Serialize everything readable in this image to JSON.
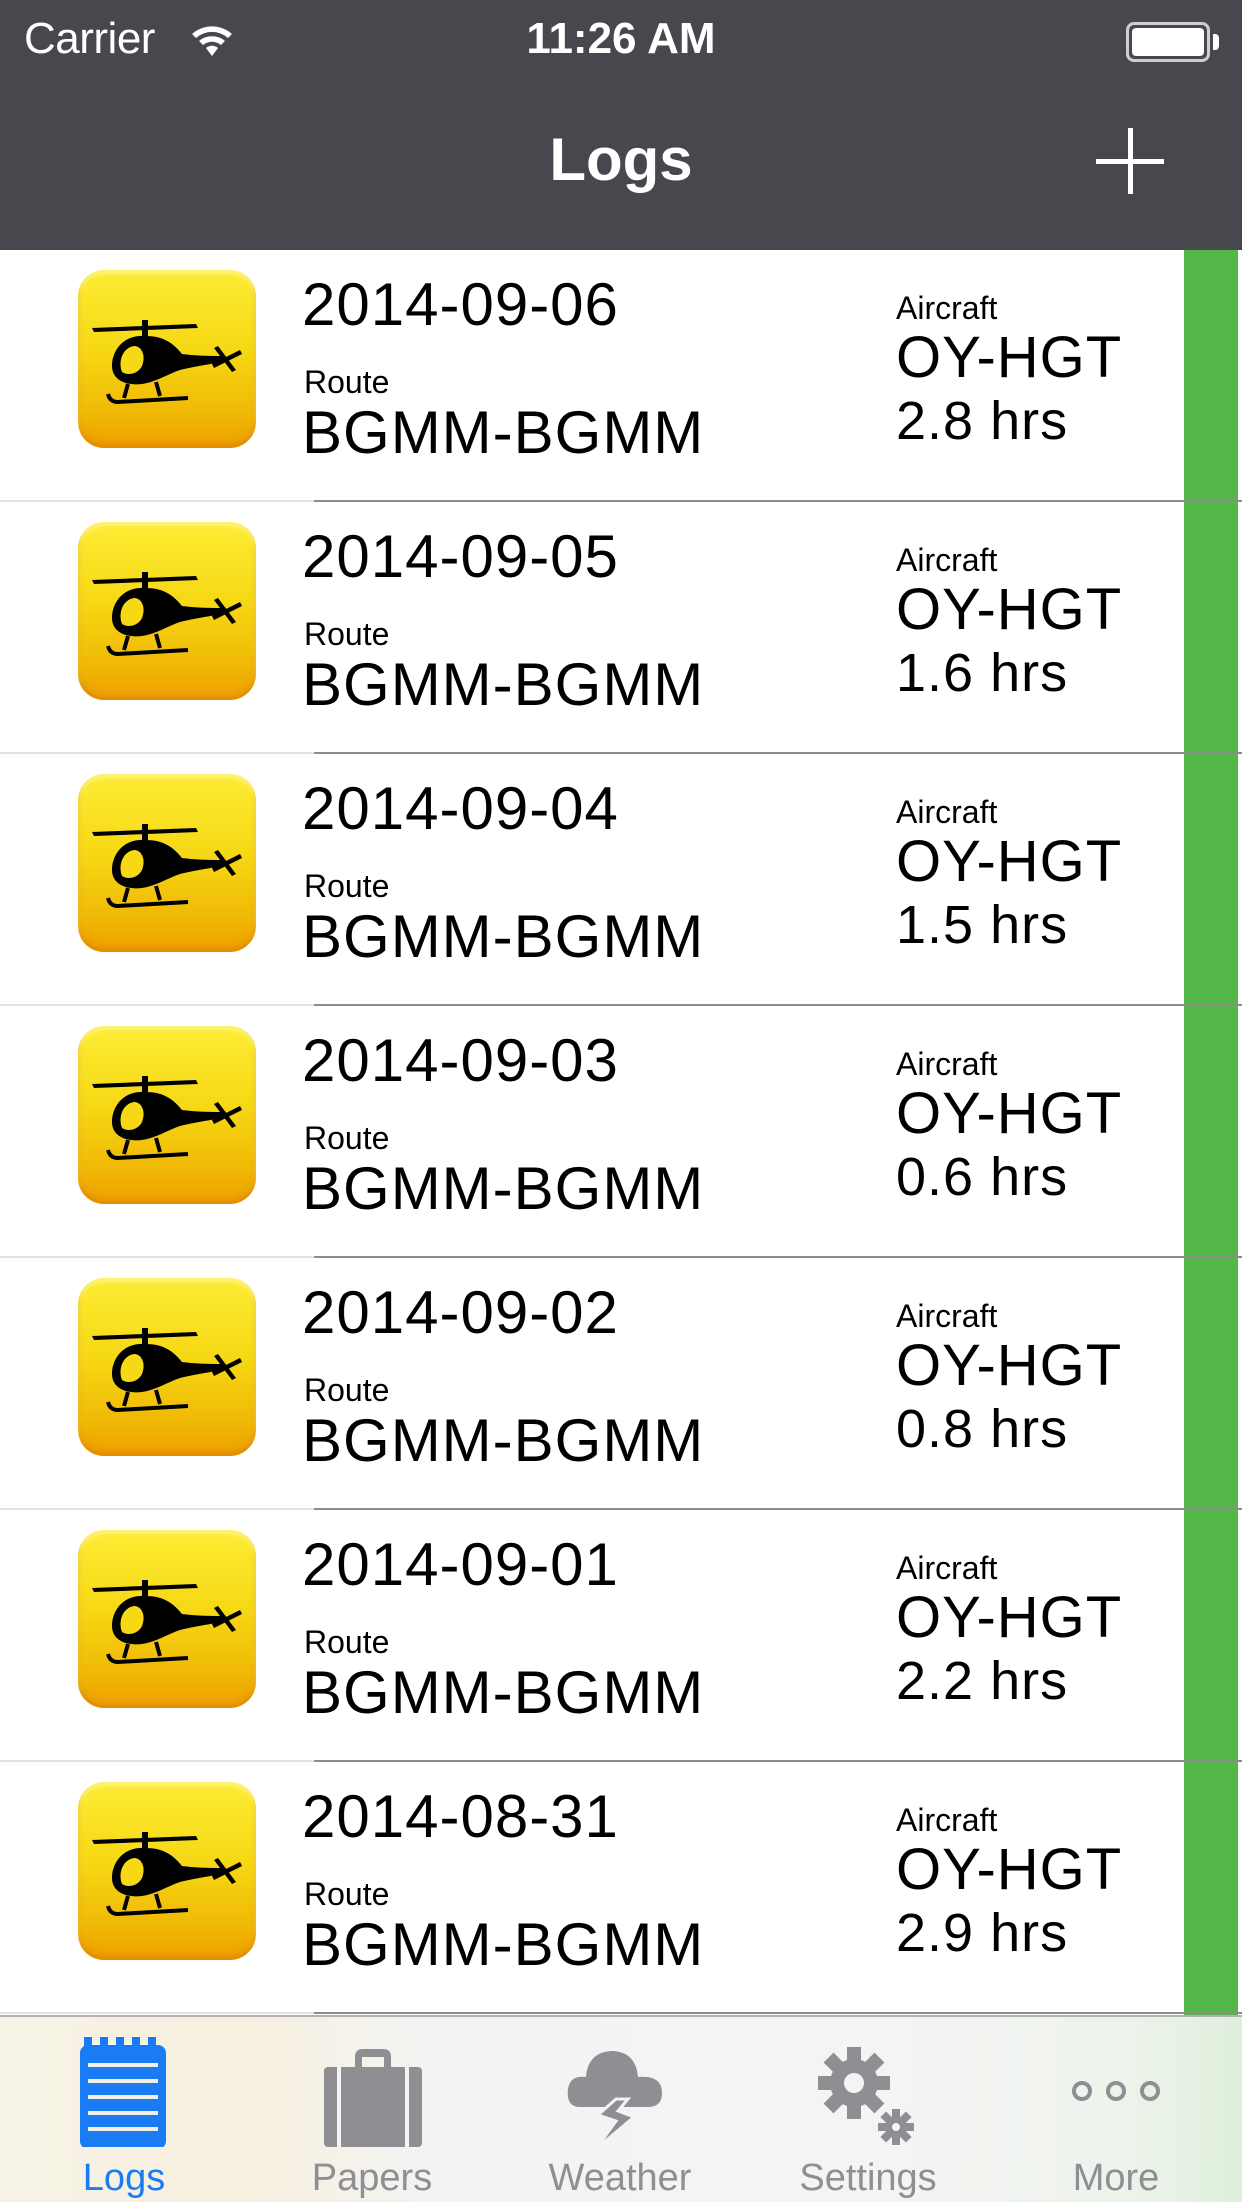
{
  "status_bar": {
    "carrier": "Carrier",
    "time": "11:26 AM",
    "battery_level": 1.0
  },
  "nav": {
    "title": "Logs",
    "add_icon": "plus-icon"
  },
  "colors": {
    "nav_bg": "#47484d",
    "accent_green": "#52b648",
    "tab_active": "#1a7cf5",
    "tab_inactive": "#8e8e93"
  },
  "logs": [
    {
      "date": "2014-09-06",
      "route_label": "Route",
      "route": "BGMM-BGMM",
      "aircraft_label": "Aircraft",
      "aircraft": "OY-HGT",
      "hours": "2.8 hrs",
      "icon": "helicopter-icon"
    },
    {
      "date": "2014-09-05",
      "route_label": "Route",
      "route": "BGMM-BGMM",
      "aircraft_label": "Aircraft",
      "aircraft": "OY-HGT",
      "hours": "1.6 hrs",
      "icon": "helicopter-icon"
    },
    {
      "date": "2014-09-04",
      "route_label": "Route",
      "route": "BGMM-BGMM",
      "aircraft_label": "Aircraft",
      "aircraft": "OY-HGT",
      "hours": "1.5 hrs",
      "icon": "helicopter-icon"
    },
    {
      "date": "2014-09-03",
      "route_label": "Route",
      "route": "BGMM-BGMM",
      "aircraft_label": "Aircraft",
      "aircraft": "OY-HGT",
      "hours": "0.6 hrs",
      "icon": "helicopter-icon"
    },
    {
      "date": "2014-09-02",
      "route_label": "Route",
      "route": "BGMM-BGMM",
      "aircraft_label": "Aircraft",
      "aircraft": "OY-HGT",
      "hours": "0.8 hrs",
      "icon": "helicopter-icon"
    },
    {
      "date": "2014-09-01",
      "route_label": "Route",
      "route": "BGMM-BGMM",
      "aircraft_label": "Aircraft",
      "aircraft": "OY-HGT",
      "hours": "2.2 hrs",
      "icon": "helicopter-icon"
    },
    {
      "date": "2014-08-31",
      "route_label": "Route",
      "route": "BGMM-BGMM",
      "aircraft_label": "Aircraft",
      "aircraft": "OY-HGT",
      "hours": "2.9 hrs",
      "icon": "helicopter-icon"
    }
  ],
  "tabs": [
    {
      "label": "Logs",
      "icon": "notepad-icon",
      "active": true
    },
    {
      "label": "Papers",
      "icon": "briefcase-icon",
      "active": false
    },
    {
      "label": "Weather",
      "icon": "storm-cloud-icon",
      "active": false
    },
    {
      "label": "Settings",
      "icon": "gears-icon",
      "active": false
    },
    {
      "label": "More",
      "icon": "more-dots-icon",
      "active": false
    }
  ]
}
